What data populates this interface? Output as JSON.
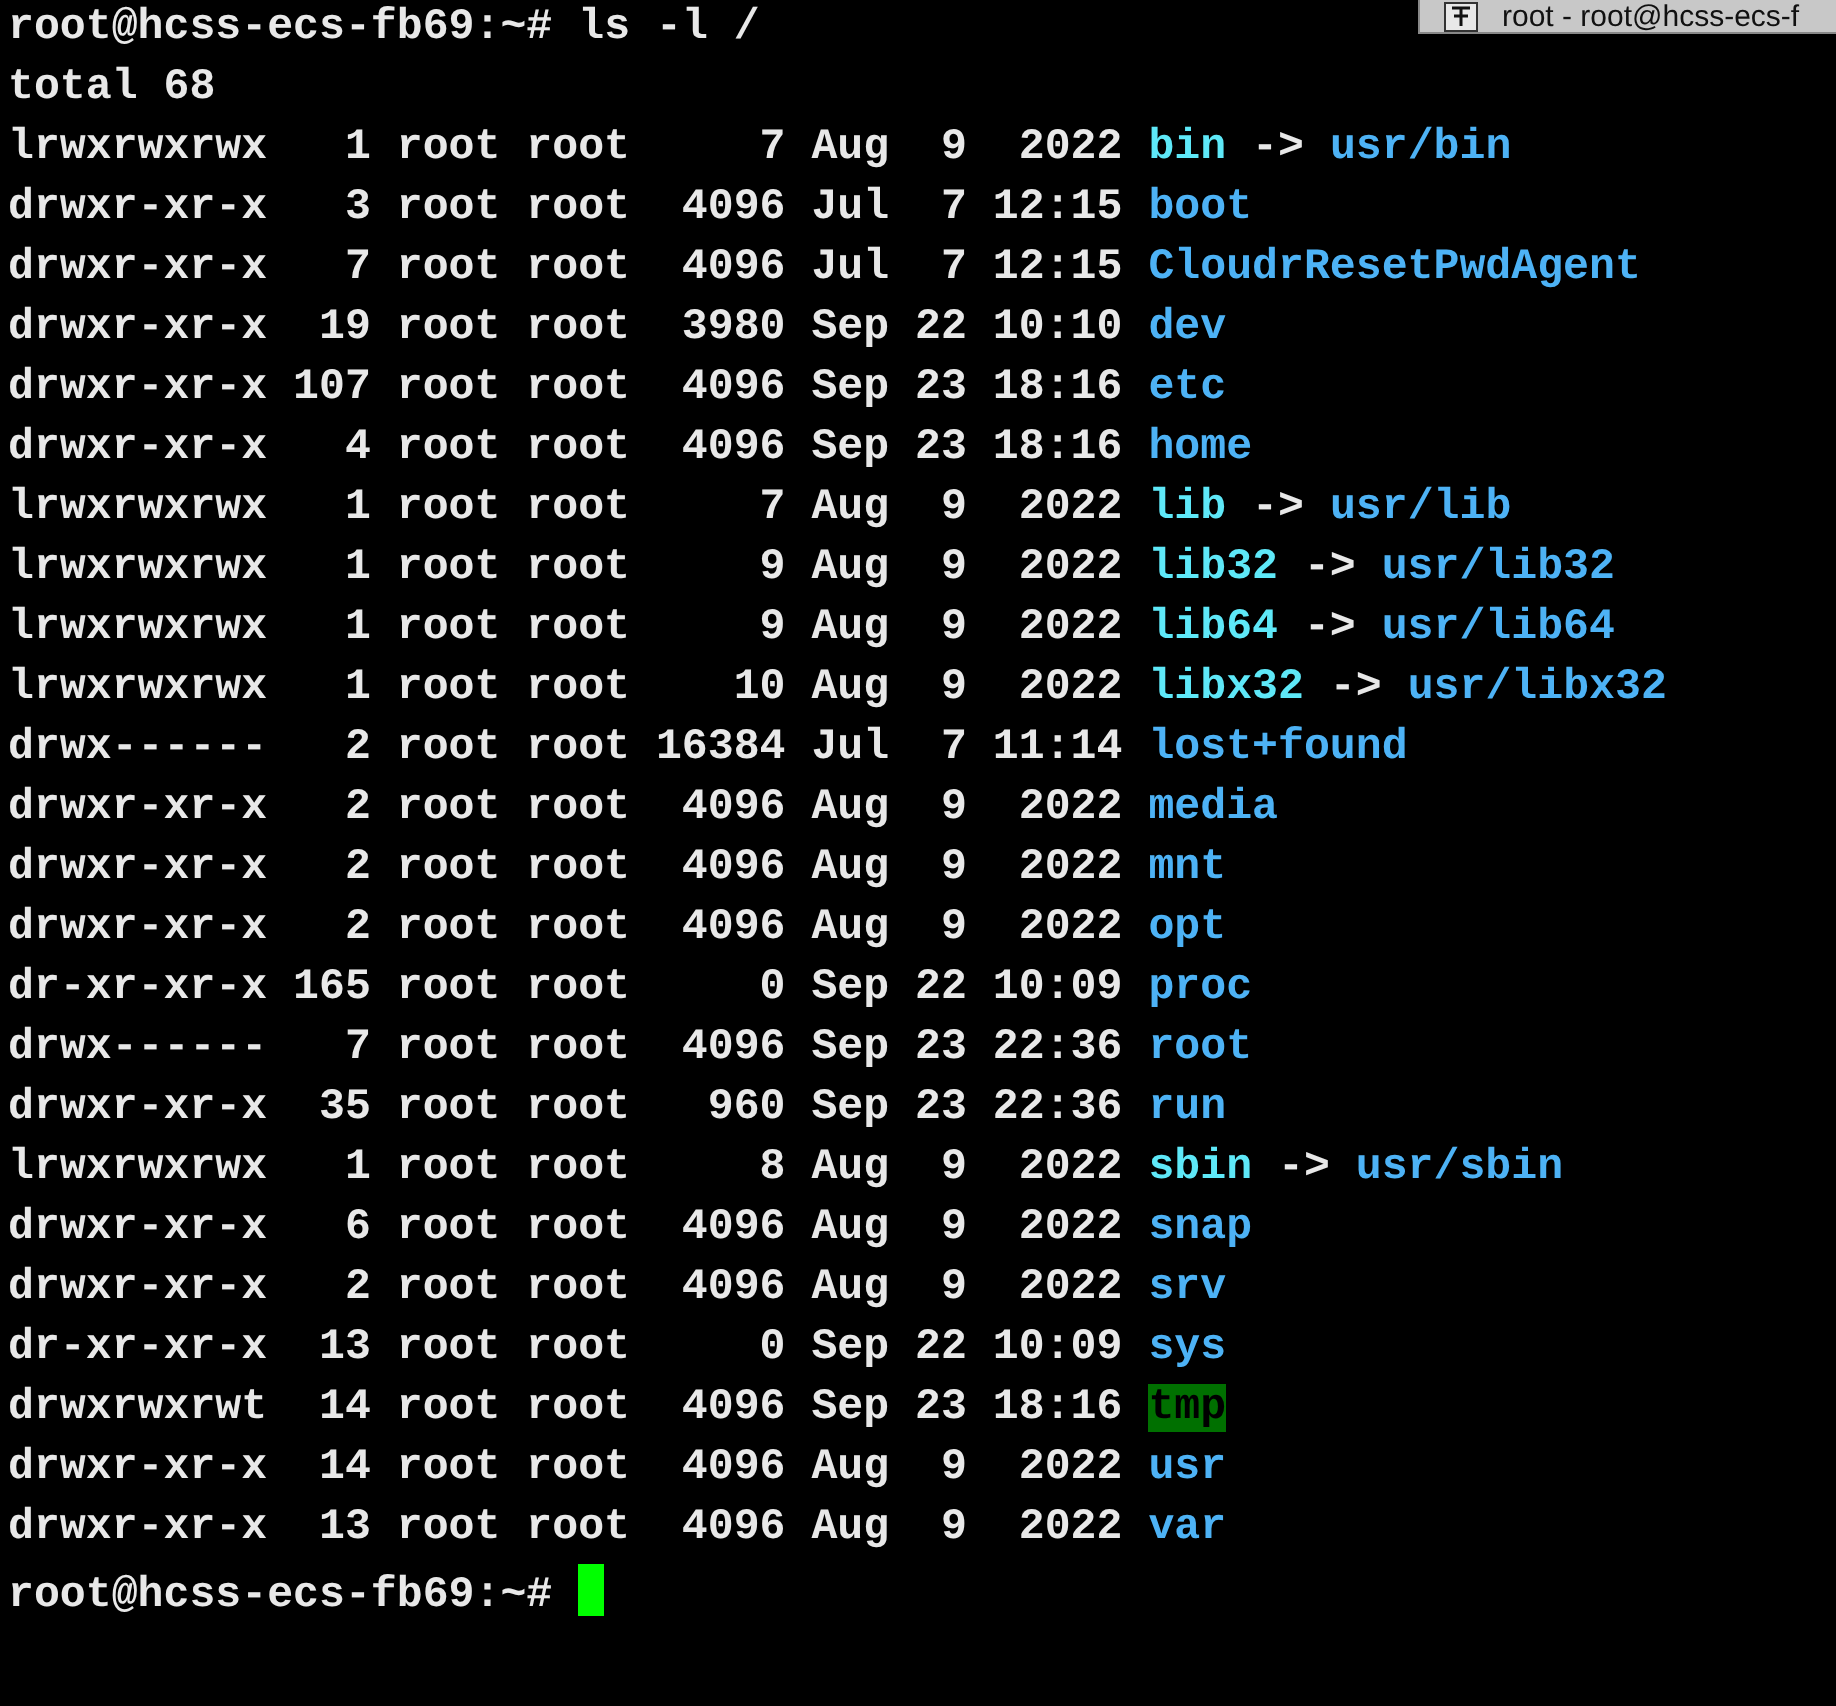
{
  "title_tab": {
    "text": "root - root@hcss-ecs-f"
  },
  "command": {
    "prompt": "root@hcss-ecs-fb69:~#",
    "text": "ls -l /"
  },
  "total": "total 68",
  "entries": [
    {
      "details": "lrwxrwxrwx   1 root root     7 Aug  9  2022",
      "name": "bin",
      "kind": "link",
      "arrow": "->",
      "target": "usr/bin"
    },
    {
      "details": "drwxr-xr-x   3 root root  4096 Jul  7 12:15",
      "name": "boot",
      "kind": "dir"
    },
    {
      "details": "drwxr-xr-x   7 root root  4096 Jul  7 12:15",
      "name": "CloudrResetPwdAgent",
      "kind": "dir"
    },
    {
      "details": "drwxr-xr-x  19 root root  3980 Sep 22 10:10",
      "name": "dev",
      "kind": "dir"
    },
    {
      "details": "drwxr-xr-x 107 root root  4096 Sep 23 18:16",
      "name": "etc",
      "kind": "dir"
    },
    {
      "details": "drwxr-xr-x   4 root root  4096 Sep 23 18:16",
      "name": "home",
      "kind": "dir"
    },
    {
      "details": "lrwxrwxrwx   1 root root     7 Aug  9  2022",
      "name": "lib",
      "kind": "link",
      "arrow": "->",
      "target": "usr/lib"
    },
    {
      "details": "lrwxrwxrwx   1 root root     9 Aug  9  2022",
      "name": "lib32",
      "kind": "link",
      "arrow": "->",
      "target": "usr/lib32"
    },
    {
      "details": "lrwxrwxrwx   1 root root     9 Aug  9  2022",
      "name": "lib64",
      "kind": "link",
      "arrow": "->",
      "target": "usr/lib64"
    },
    {
      "details": "lrwxrwxrwx   1 root root    10 Aug  9  2022",
      "name": "libx32",
      "kind": "link",
      "arrow": "->",
      "target": "usr/libx32"
    },
    {
      "details": "drwx------   2 root root 16384 Jul  7 11:14",
      "name": "lost+found",
      "kind": "dir"
    },
    {
      "details": "drwxr-xr-x   2 root root  4096 Aug  9  2022",
      "name": "media",
      "kind": "dir"
    },
    {
      "details": "drwxr-xr-x   2 root root  4096 Aug  9  2022",
      "name": "mnt",
      "kind": "dir"
    },
    {
      "details": "drwxr-xr-x   2 root root  4096 Aug  9  2022",
      "name": "opt",
      "kind": "dir"
    },
    {
      "details": "dr-xr-xr-x 165 root root     0 Sep 22 10:09",
      "name": "proc",
      "kind": "dir"
    },
    {
      "details": "drwx------   7 root root  4096 Sep 23 22:36",
      "name": "root",
      "kind": "dir"
    },
    {
      "details": "drwxr-xr-x  35 root root   960 Sep 23 22:36",
      "name": "run",
      "kind": "dir"
    },
    {
      "details": "lrwxrwxrwx   1 root root     8 Aug  9  2022",
      "name": "sbin",
      "kind": "link",
      "arrow": "->",
      "target": "usr/sbin"
    },
    {
      "details": "drwxr-xr-x   6 root root  4096 Aug  9  2022",
      "name": "snap",
      "kind": "dir"
    },
    {
      "details": "drwxr-xr-x   2 root root  4096 Aug  9  2022",
      "name": "srv",
      "kind": "dir"
    },
    {
      "details": "dr-xr-xr-x  13 root root     0 Sep 22 10:09",
      "name": "sys",
      "kind": "dir"
    },
    {
      "details": "drwxrwxrwt  14 root root  4096 Sep 23 18:16",
      "name": "tmp",
      "kind": "sticky"
    },
    {
      "details": "drwxr-xr-x  14 root root  4096 Aug  9  2022",
      "name": "usr",
      "kind": "dir"
    },
    {
      "details": "drwxr-xr-x  13 root root  4096 Aug  9  2022",
      "name": "var",
      "kind": "dir"
    }
  ],
  "final_prompt": {
    "prompt": "root@hcss-ecs-fb69:~#"
  }
}
